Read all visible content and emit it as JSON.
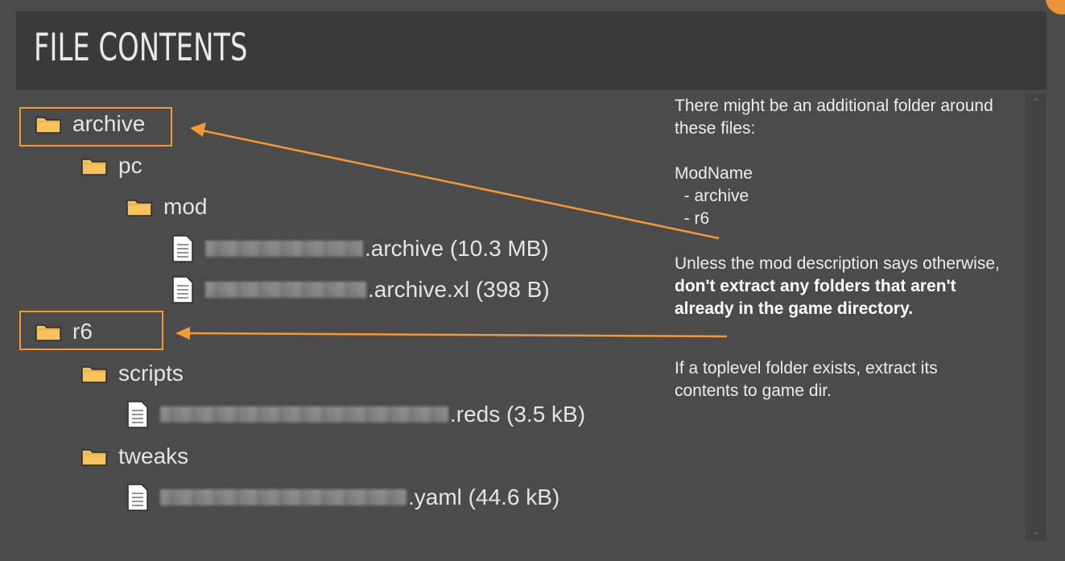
{
  "panel": {
    "title": "FILE CONTENTS"
  },
  "tree": {
    "archive": "archive",
    "pc": "pc",
    "mod": "mod",
    "file1_ext": ".archive (10.3 MB)",
    "file2_ext": ".archive.xl (398 B)",
    "r6": "r6",
    "scripts": "scripts",
    "file3_ext": ".reds (3.5 kB)",
    "tweaks": "tweaks",
    "file4_ext": ".yaml (44.6 kB)"
  },
  "notes": {
    "line1": "There might be an additional folder around",
    "line2": "these files:",
    "line3": "ModName",
    "line4": "  - archive",
    "line5": "  - r6",
    "line6": "Unless the mod description says otherwise,",
    "bold1": "don't extract any folders that aren't",
    "bold2": "already in the game directory.",
    "line7": "If a toplevel folder exists, extract its",
    "line8": "contents to game dir."
  },
  "colors": {
    "background": "#4b4b4b",
    "header": "#3a3a3a",
    "highlight": "#f39a37",
    "folder": "#f7c25c"
  },
  "icons": {
    "folder": "folder-icon",
    "file": "file-icon",
    "scroll_up": "chevron-up-icon",
    "scroll_down": "chevron-down-icon"
  }
}
